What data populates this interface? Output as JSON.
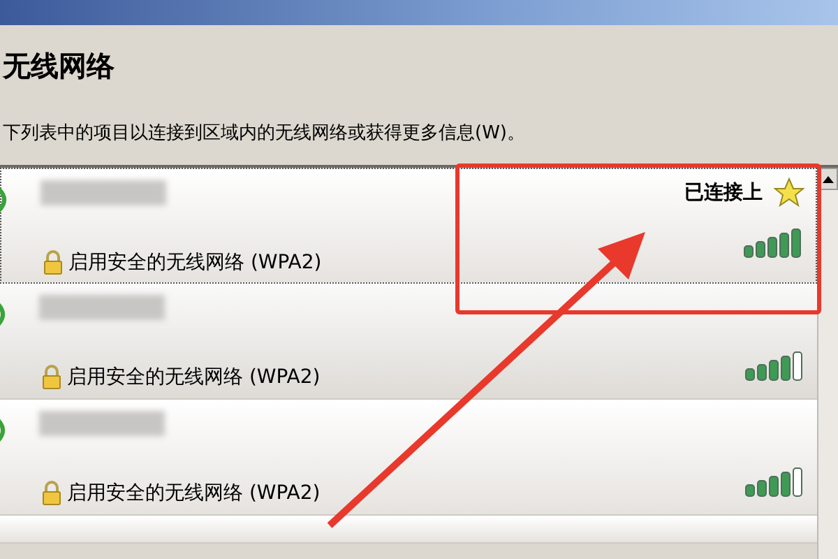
{
  "heading": "无线网络",
  "description": "下列表中的项目以连接到区域内的无线网络或获得更多信息(W)。",
  "networks": [
    {
      "security": "启用安全的无线网络 (WPA2)",
      "connected": true,
      "status": "已连接上",
      "full_signal": true,
      "selected": true
    },
    {
      "security": "启用安全的无线网络 (WPA2)",
      "connected": false,
      "full_signal": false,
      "selected": false
    },
    {
      "security": "启用安全的无线网络 (WPA2)",
      "connected": false,
      "full_signal": false,
      "selected": false
    }
  ]
}
